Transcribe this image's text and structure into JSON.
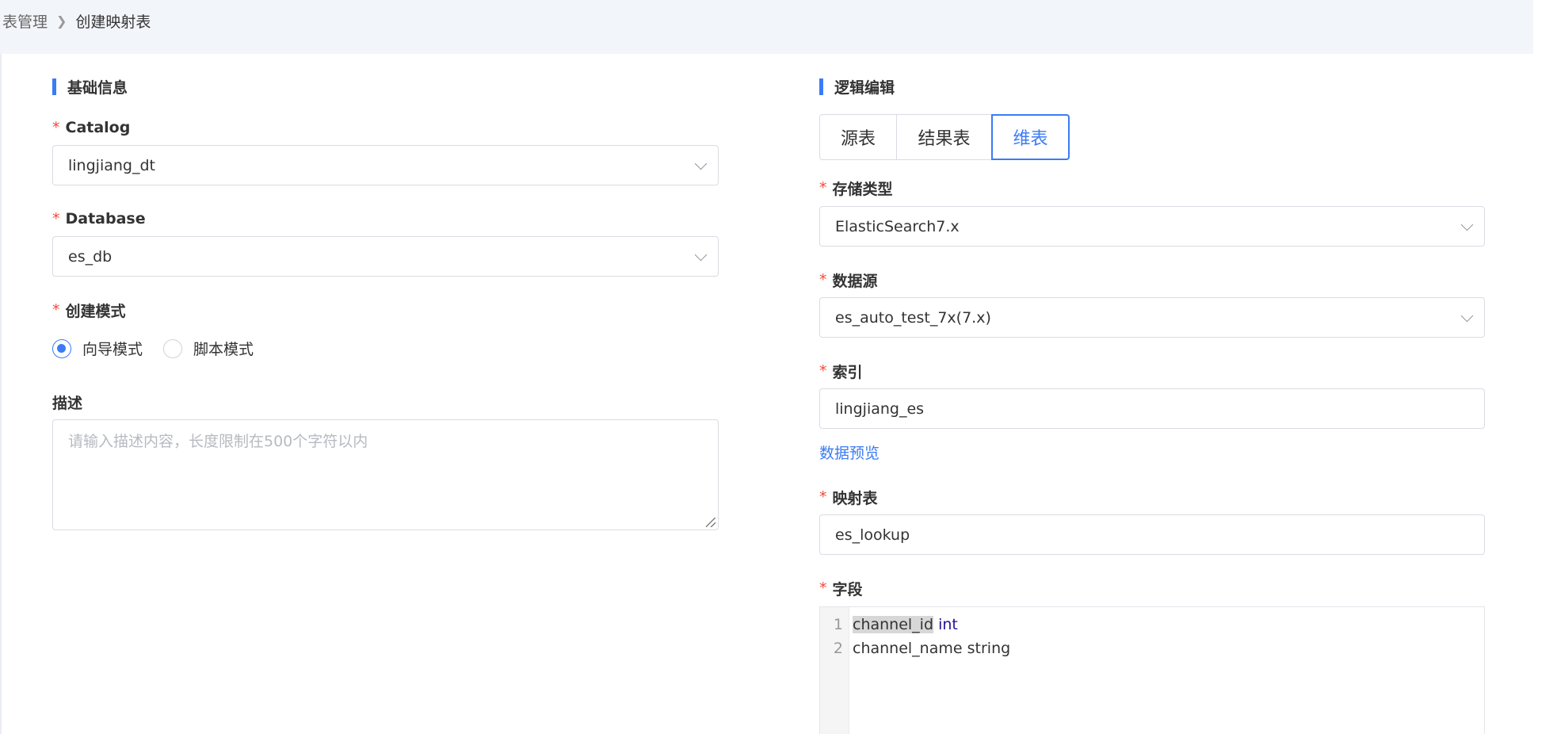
{
  "breadcrumb": {
    "parent": "表管理",
    "current": "创建映射表"
  },
  "basic_info": {
    "title": "基础信息",
    "catalog": {
      "label": "Catalog",
      "value": "lingjiang_dt"
    },
    "database": {
      "label": "Database",
      "value": "es_db"
    },
    "create_mode": {
      "label": "创建模式",
      "options": [
        "向导模式",
        "脚本模式"
      ],
      "selected": "向导模式"
    },
    "description": {
      "label": "描述",
      "placeholder": "请输入描述内容，长度限制在500个字符以内"
    }
  },
  "logic_edit": {
    "title": "逻辑编辑",
    "tabs": [
      "源表",
      "结果表",
      "维表"
    ],
    "active_tab": "维表",
    "storage_type": {
      "label": "存储类型",
      "value": "ElasticSearch7.x"
    },
    "datasource": {
      "label": "数据源",
      "value": "es_auto_test_7x(7.x)"
    },
    "index": {
      "label": "索引",
      "value": "lingjiang_es"
    },
    "preview_link": "数据预览",
    "mapping_table": {
      "label": "映射表",
      "value": "es_lookup"
    },
    "fields": {
      "label": "字段",
      "lines": [
        {
          "num": "1",
          "name": "channel_id",
          "type": "int"
        },
        {
          "num": "2",
          "name": "channel_name",
          "type": "string"
        }
      ]
    }
  },
  "required_mark": "*",
  "colors": {
    "primary": "#3b7cf5",
    "required": "#f5483b",
    "header_bg": "#f2f5f9"
  }
}
